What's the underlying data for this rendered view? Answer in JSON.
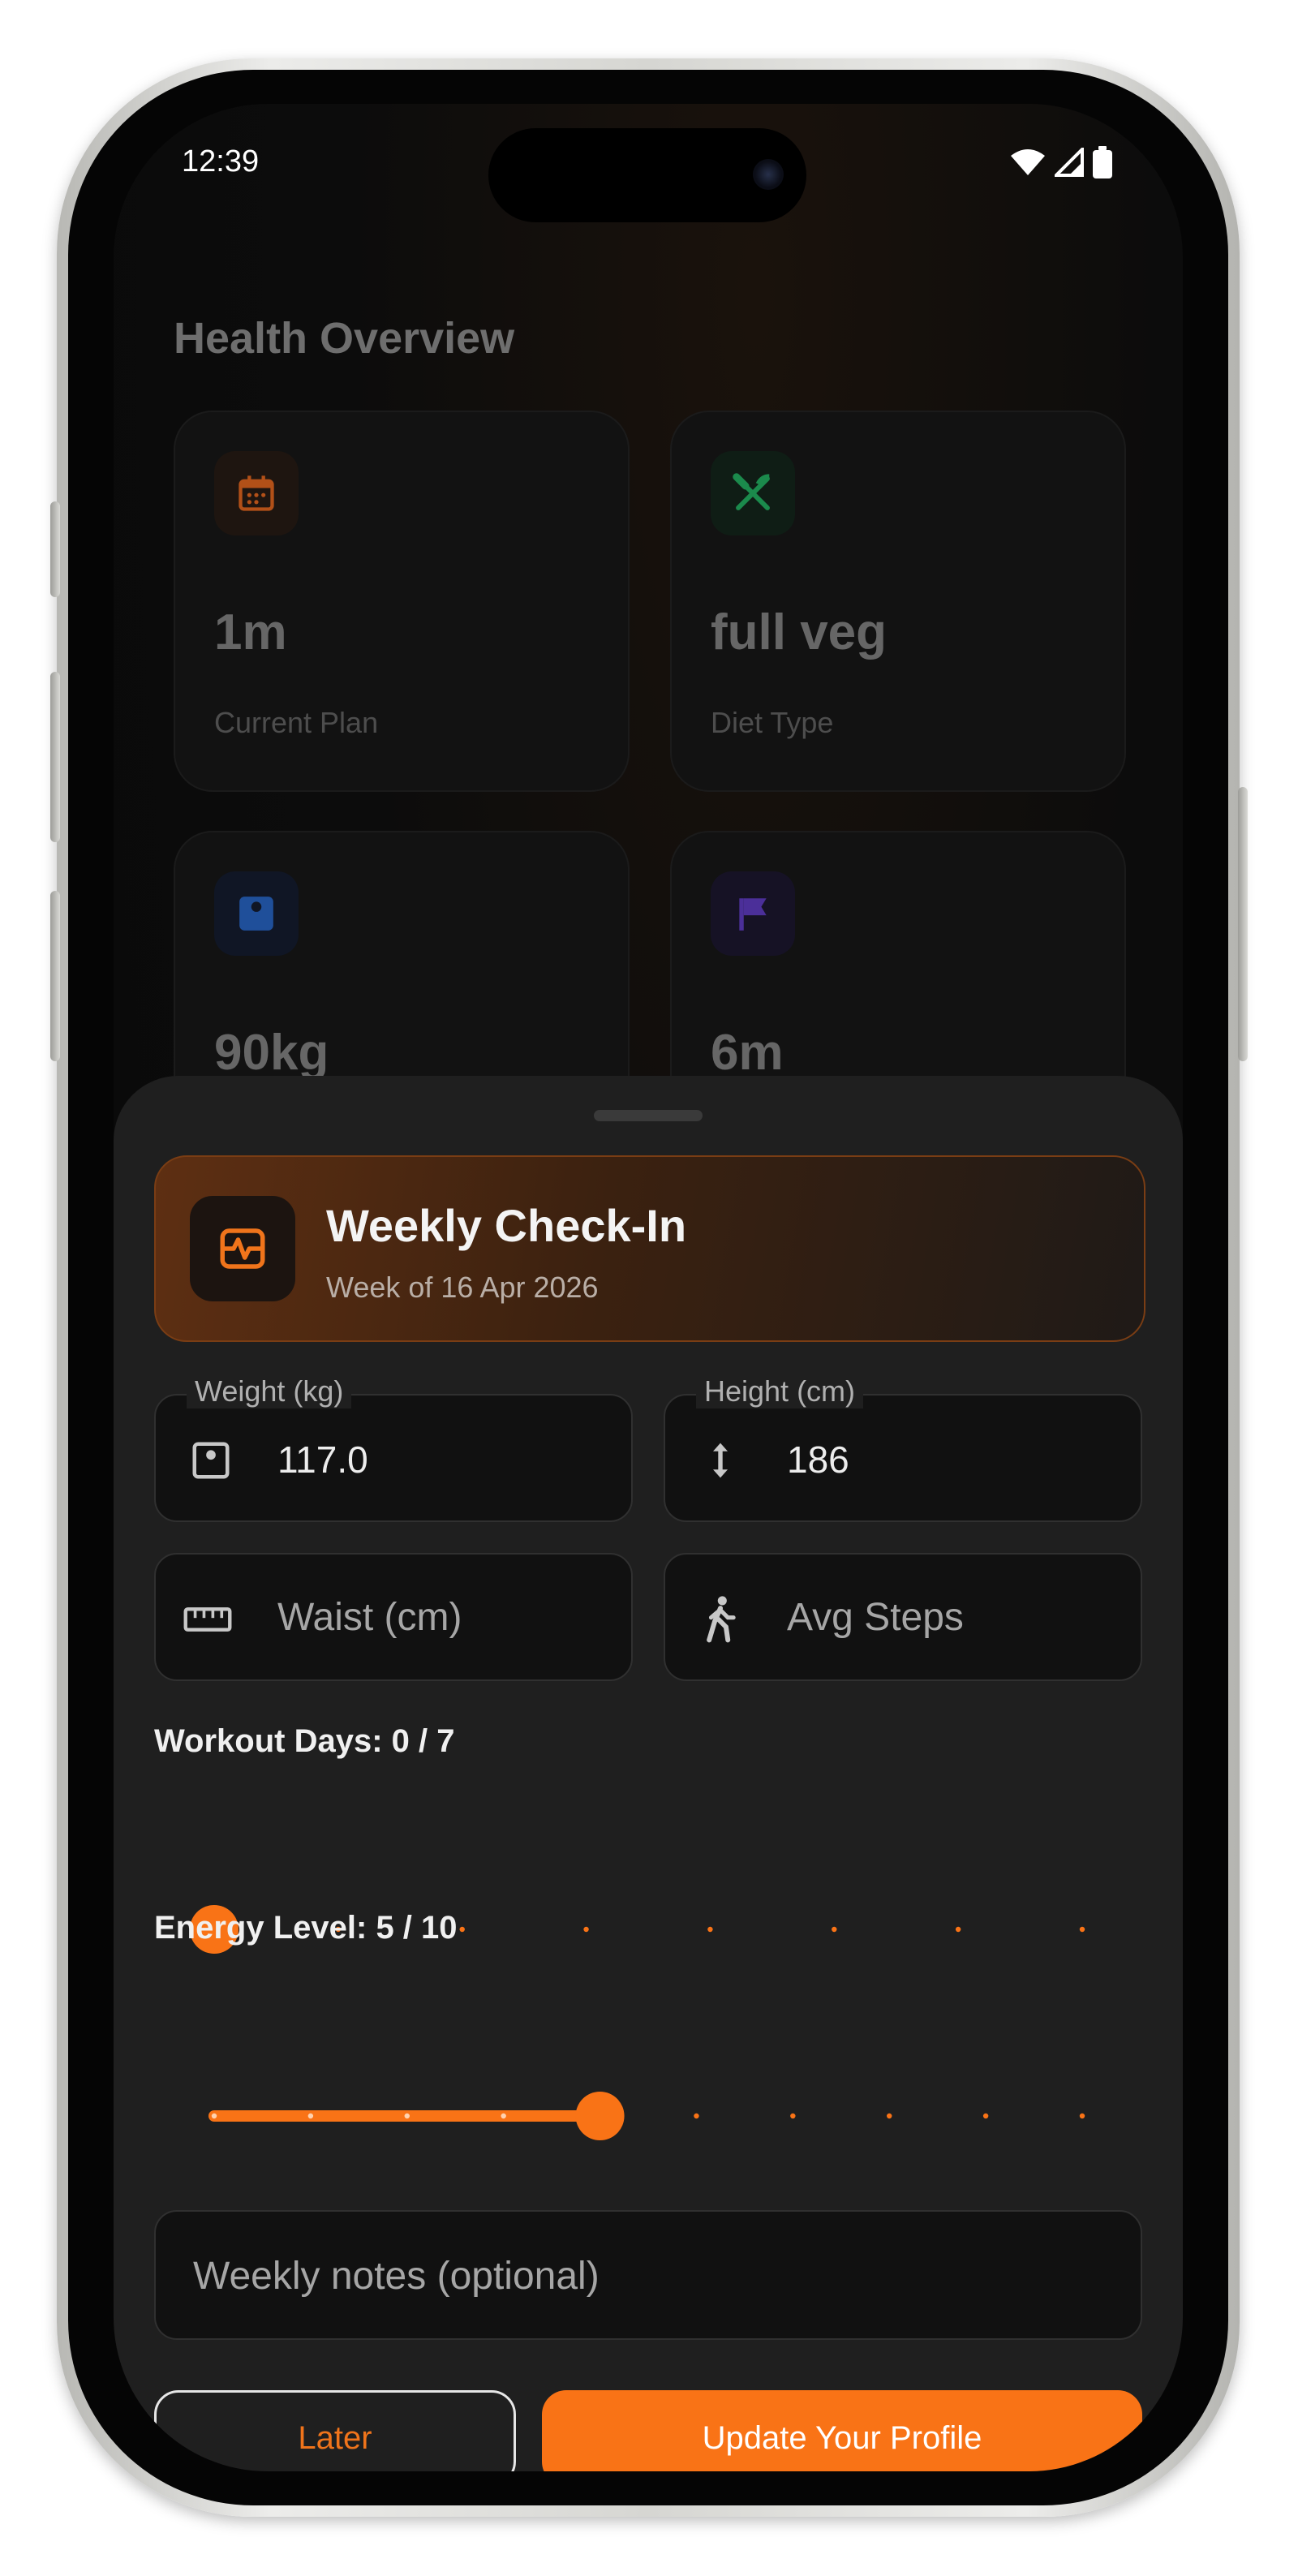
{
  "status_bar": {
    "time": "12:39"
  },
  "overview": {
    "title": "Health Overview",
    "cards": [
      {
        "value": "1m",
        "label": "Current Plan",
        "icon": "calendar-icon",
        "accent": "#c2561a"
      },
      {
        "value": "full veg",
        "label": "Diet Type",
        "icon": "fork-knife-icon",
        "accent": "#1f9a55"
      },
      {
        "value": "90kg",
        "label": "",
        "icon": "scale-icon",
        "accent": "#2f6fd4"
      },
      {
        "value": "6m",
        "label": "",
        "icon": "flag-icon",
        "accent": "#6a40c9"
      }
    ]
  },
  "checkin": {
    "title": "Weekly Check-In",
    "subtitle": "Week of 16 Apr 2026",
    "weight": {
      "label": "Weight (kg)",
      "value": "117.0"
    },
    "height": {
      "label": "Height (cm)",
      "value": "186"
    },
    "waist": {
      "placeholder": "Waist (cm)"
    },
    "steps": {
      "placeholder": "Avg Steps"
    },
    "workout": {
      "label": "Workout Days: 0 / 7",
      "value": 0,
      "max": 7
    },
    "energy": {
      "label": "Energy Level: 5 / 10",
      "value": 5,
      "min": 1,
      "max": 10
    },
    "notes": {
      "placeholder": "Weekly notes (optional)"
    },
    "later_label": "Later",
    "update_label": "Update Your Profile"
  },
  "colors": {
    "accent": "#f97316"
  }
}
